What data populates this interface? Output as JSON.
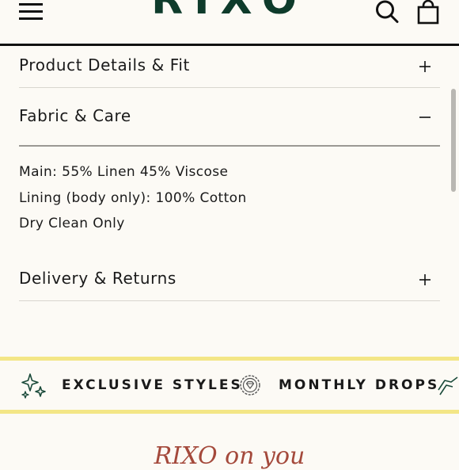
{
  "header": {
    "logo_text": "RIXO",
    "icons": [
      "menu-icon",
      "search-icon",
      "shopping-bag-icon"
    ],
    "brand_color": "#0e3b2b"
  },
  "accordion": {
    "sections": [
      {
        "title": "Product Details & Fit",
        "state": "collapsed"
      },
      {
        "title": "Fabric & Care",
        "state": "expanded"
      },
      {
        "title": "Delivery & Returns",
        "state": "collapsed"
      }
    ],
    "fabric_care_lines": [
      "Main: 55% Linen 45% Viscose",
      "Lining (body only): 100% Cotton",
      "Dry Clean Only"
    ]
  },
  "band": {
    "items": [
      {
        "label": "EXCLUSIVE STYLES",
        "icon": "sparkles-icon"
      },
      {
        "label": "MONTHLY DROPS",
        "icon": "diamond-badge-icon"
      }
    ],
    "accent_color": "#f3e686"
  },
  "footer": {
    "title": "RIXO on you",
    "title_color": "#a4493b"
  }
}
